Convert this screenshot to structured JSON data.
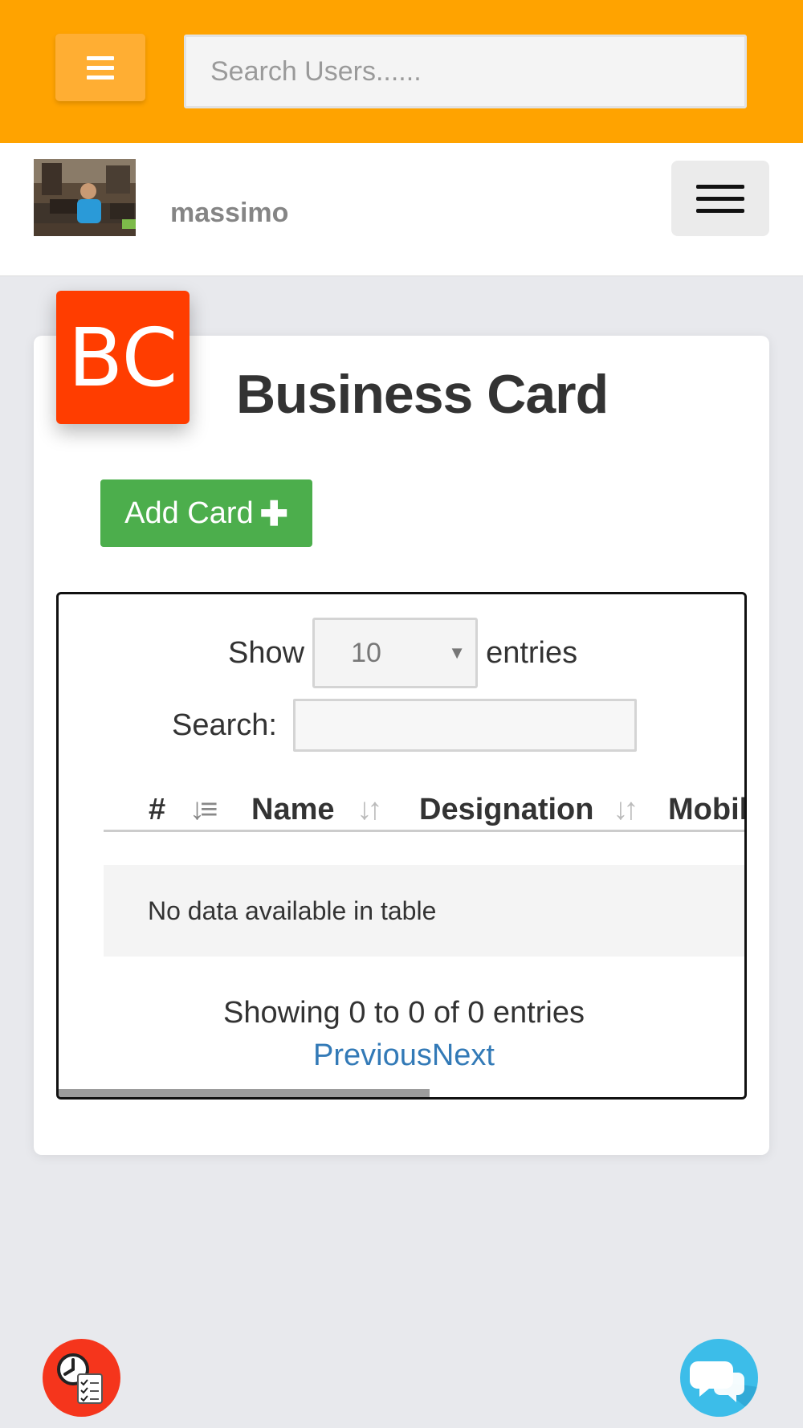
{
  "topbar": {
    "search_placeholder": "Search Users......"
  },
  "profile": {
    "username": "massimo"
  },
  "card": {
    "badge": "BC",
    "title": "Business Card",
    "add_label": "Add Card"
  },
  "table": {
    "show_label": "Show",
    "page_size": "10",
    "entries_label": "entries",
    "search_label": "Search:",
    "columns": [
      "#",
      "Name",
      "Designation",
      "Mobil"
    ],
    "empty_message": "No data available in table",
    "info": "Showing 0 to 0 of 0 entries",
    "previous": "Previous",
    "next": "Next"
  },
  "colors": {
    "topbar": "#ffa300",
    "badge": "#ff3d00",
    "add_button": "#4cae4c",
    "link": "#337ab7",
    "chat_fab": "#3cbde9",
    "task_fab": "#f5351c"
  },
  "icons": {
    "menu": "hamburger-icon",
    "nav": "hamburger-icon",
    "add": "plus-icon",
    "sort_asc": "sort-numeric-asc-icon",
    "sort": "sort-icon",
    "select_caret": "caret-down-icon",
    "task": "clock-checklist-icon",
    "chat": "chat-bubbles-icon"
  }
}
